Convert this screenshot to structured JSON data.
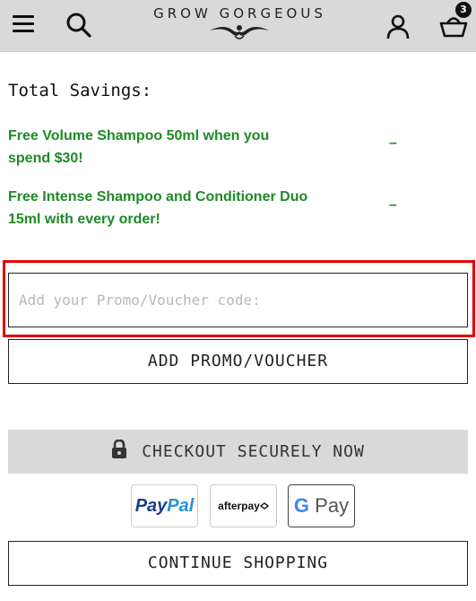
{
  "header": {
    "brand": "GROW GORGEOUS",
    "basket_count": "3",
    "icons": [
      "menu-icon",
      "search-icon",
      "brand-ornament-icon",
      "account-icon",
      "basket-icon"
    ]
  },
  "savings": {
    "title": "Total Savings:",
    "offers": [
      {
        "text": "Free Volume Shampoo 50ml when you spend $30!",
        "value": "–"
      },
      {
        "text": "Free Intense Shampoo and Conditioner Duo 15ml with every order!",
        "value": "–"
      }
    ]
  },
  "promo": {
    "placeholder": "Add your Promo/Voucher code:",
    "value": "",
    "button_label": "ADD PROMO/VOUCHER"
  },
  "checkout": {
    "label": "CHECKOUT SECURELY NOW",
    "icon": "lock-icon"
  },
  "payment_methods": {
    "paypal_a": "Pay",
    "paypal_b": "Pal",
    "afterpay": "afterpay",
    "gpay_g": "G",
    "gpay_text": "Pay"
  },
  "continue": {
    "label": "CONTINUE SHOPPING"
  },
  "colors": {
    "offer_green": "#1e8a26",
    "highlight_red": "#e00000",
    "header_bg": "#d9d9d9"
  }
}
